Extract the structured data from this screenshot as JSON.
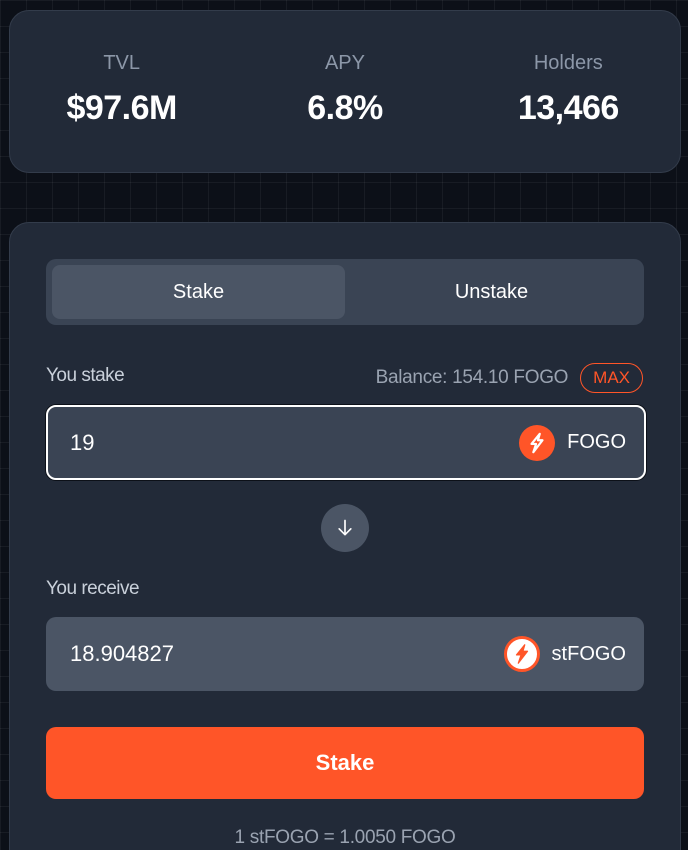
{
  "stats": {
    "tvl": {
      "label": "TVL",
      "value": "$97.6M"
    },
    "apy": {
      "label": "APY",
      "value": "6.8%"
    },
    "holders": {
      "label": "Holders",
      "value": "13,466"
    }
  },
  "tabs": {
    "stake": "Stake",
    "unstake": "Unstake",
    "active": "Stake"
  },
  "stake_input": {
    "label": "You stake",
    "balance": "Balance: 154.10 FOGO",
    "max_label": "MAX",
    "value": "19",
    "token": "FOGO"
  },
  "receive": {
    "label": "You receive",
    "value": "18.904827",
    "token": "stFOGO"
  },
  "action_button": "Stake",
  "exchange_rate": "1 stFOGO = 1.0050 FOGO",
  "colors": {
    "accent": "#ff5528",
    "card": "#222a38",
    "field": "#3a4454",
    "background": "#0c1018"
  },
  "icons": {
    "token_fogo": "fogo-bolt-icon",
    "token_stfogo": "stfogo-bolt-icon",
    "swap_direction": "arrow-down-icon"
  }
}
